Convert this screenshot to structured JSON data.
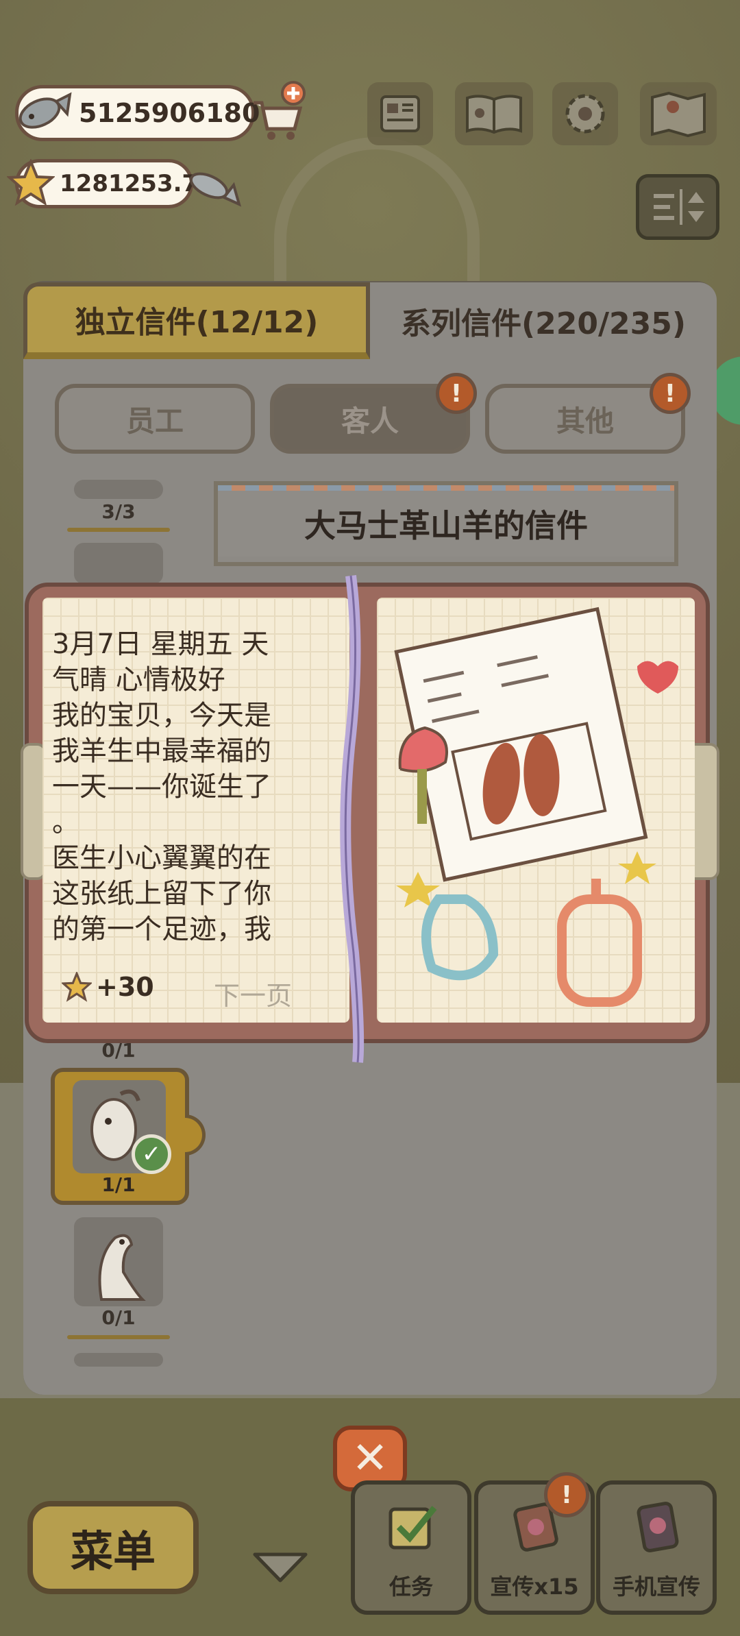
{
  "currency": {
    "fish_amount": "5125906180",
    "star_amount": "1281253.7"
  },
  "tabs": [
    {
      "label": "独立信件(12/12)",
      "active": true
    },
    {
      "label": "系列信件(220/235)",
      "active": false
    }
  ],
  "categories": [
    {
      "label": "员工",
      "badge": ""
    },
    {
      "label": "客人",
      "badge": "!"
    },
    {
      "label": "其他",
      "badge": "!"
    }
  ],
  "list": {
    "items": [
      {
        "count": "3/3"
      },
      {
        "count": "0/1"
      },
      {
        "count": "1/1",
        "selected": true
      },
      {
        "count": "0/1"
      }
    ]
  },
  "letter": {
    "title": "大马士革山羊的信件",
    "body": "3月7日 星期五 天\n气晴 心情极好\n我的宝贝，今天是\n我羊生中最幸福的\n一天——你诞生了\n。\n医生小心翼翼的在\n这张纸上留下了你\n的第一个足迹，我",
    "reward": "+30",
    "next_page": "下一页"
  },
  "bottom": {
    "close_symbol": "✕",
    "menu_label": "菜单",
    "task_label": "任务",
    "promo_label": "宣传x15",
    "promo_badge": "!",
    "phone_promo_label": "手机宣传"
  },
  "colors": {
    "accent_gold": "#b39a4a",
    "close_orange": "#d46a3a",
    "badge_orange": "#b35a2a"
  }
}
